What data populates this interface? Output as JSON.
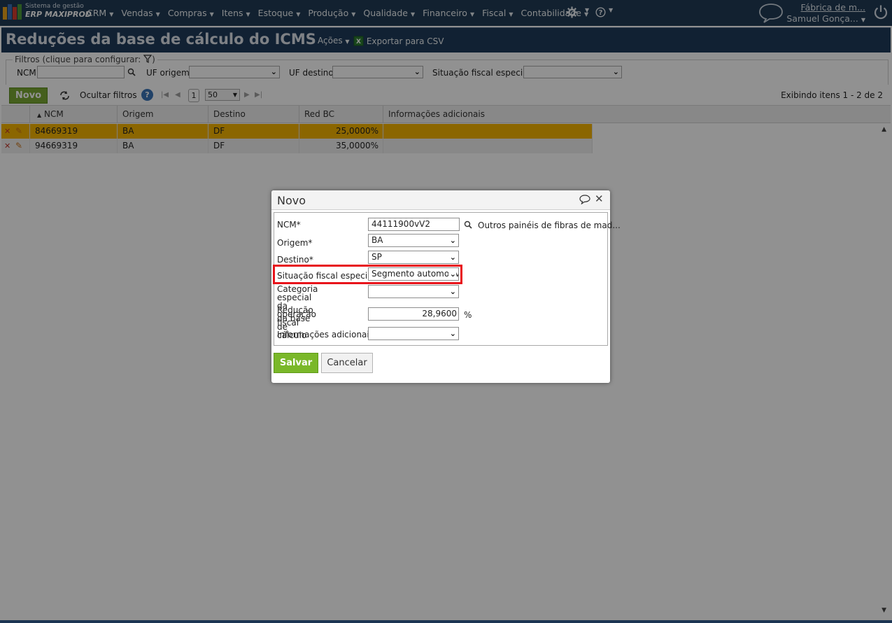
{
  "topnav": {
    "brand_small": "Sistema de gestão",
    "brand_big": "ERP MAXIPROD",
    "menu": [
      "CRM",
      "Vendas",
      "Compras",
      "Itens",
      "Estoque",
      "Produção",
      "Qualidade",
      "Financeiro",
      "Fiscal",
      "Contabilidade"
    ],
    "company": "Fábrica de m...",
    "user": "Samuel Gonça..."
  },
  "header": {
    "title": "Reduções da base de cálculo do ICMS",
    "actions_label": "Ações",
    "export_label": "Exportar para CSV"
  },
  "filters": {
    "legend": "Filtros (clique para configurar:",
    "ncm_label": "NCM",
    "uf_origem_label": "UF origem",
    "uf_destino_label": "UF destino",
    "situacao_label": "Situação fiscal especial"
  },
  "toolbar": {
    "novo_label": "Novo",
    "hide_filters_label": "Ocultar filtros",
    "page_number": "1",
    "page_size": "50",
    "items_info": "Exibindo itens 1 - 2 de 2"
  },
  "grid": {
    "columns": [
      "NCM",
      "Origem",
      "Destino",
      "Red BC",
      "Informações adicionais"
    ],
    "rows": [
      {
        "ncm": "84669319",
        "origem": "BA",
        "destino": "DF",
        "red_bc": "25,0000%",
        "info": ""
      },
      {
        "ncm": "94669319",
        "origem": "BA",
        "destino": "DF",
        "red_bc": "35,0000%",
        "info": ""
      }
    ]
  },
  "dialog": {
    "title": "Novo",
    "ncm_label": "NCM*",
    "ncm_value": "44111900vV2",
    "ncm_description": "Outros painéis de fibras de mad...",
    "origem_label": "Origem*",
    "origem_value": "BA",
    "destino_label": "Destino*",
    "destino_value": "SP",
    "situacao_label": "Situação fiscal especial",
    "situacao_value": "Segmento automotivo",
    "categoria_label_1": "Categoria especial da",
    "categoria_label_2": "operação fiscal",
    "categoria_value": "",
    "reducao_label_1": "Redução da base de",
    "reducao_label_2": "cálculo",
    "reducao_value": "28,9600",
    "percent_sign": "%",
    "info_label": "Informações adicionais",
    "info_value": "",
    "save_label": "Salvar",
    "cancel_label": "Cancelar"
  },
  "colors": {
    "nav_bg": "#203a55",
    "selected_row": "#f5b400",
    "save_button": "#7ab829",
    "highlight": "#e8141b"
  }
}
